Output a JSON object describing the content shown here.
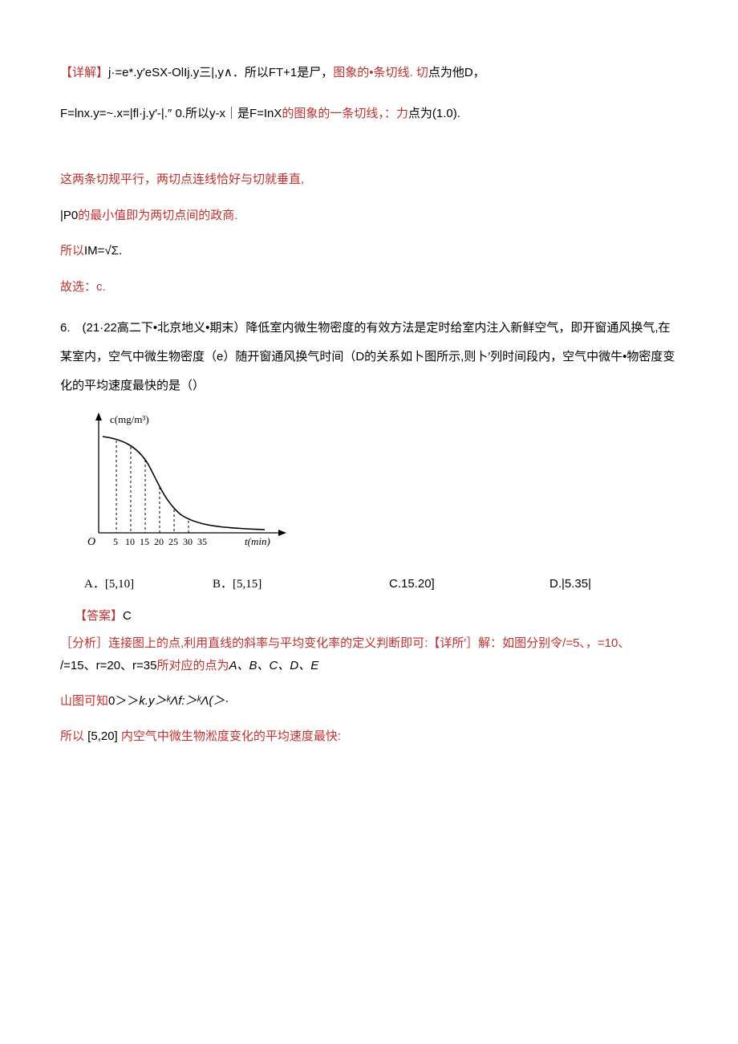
{
  "p1_prefix": "【详解】",
  "p1_body": "j·=e*.y′eSX-OlIj.y三|,y∧．所以FT+1是尸，",
  "p1_mid_red": "图象的•条切线. 切",
  "p1_tail": "点为他D，",
  "p2_body": "F=lnx.y=~.x=|fl·j.y′-|.″ 0.所以y-x｜是F=InX",
  "p2_mid_red": "的图象的一条切线，：力",
  "p2_tail": "点为(1.0).",
  "p3": "这两条切规平行，两切点连线恰好与切就垂直,",
  "p4_a": "|P0",
  "p4_b": "的最小值即为两切点间的政商.",
  "p5_a": "所以",
  "p5_b": "IM=√Σ.",
  "p6": "故选：c.",
  "q6_num": "6.　",
  "q6_src": "(21·22高二下•北京地义•期末）",
  "q6_body": "降低室内微生物密度的有效方法是定时给室内注入新鲜空气，即开窗通风换气,在某室内，空气中微生物密度（e）随开窗通风换气时间（D的关系如卜图所示,则卜′列时间段内，空气中微牛•物密度变化的平均速度最快的是（）",
  "chart": {
    "y_label": "c(mg/m³)",
    "x_label": "t(min)",
    "ticks": [
      "5",
      "10",
      "15",
      "20",
      "25",
      "30",
      "35"
    ]
  },
  "opts": {
    "a_label": "A．",
    "a_val": "[5,10]",
    "b_label": "B．",
    "b_val": "[5,15]",
    "c": "C.15.20]",
    "d": "D.|5.35|"
  },
  "ans_prefix": "【答案】",
  "ans_val": "C",
  "analysis_a": "［分析］连接图上的点,利用直线的斜率与平均变化率的定义判断即可:【详所′］解：如图分别令/=5、，=10、",
  "analysis_b_a": "/=15、r=20、r=35",
  "analysis_b_b": "所对应的点为",
  "analysis_b_c": "A、B、C、D、E",
  "p_slope": "山图可知0＞＞k.y＞ᵏΛf:＞ᵏΛ(＞·",
  "p_concl_a": "所以",
  "p_concl_b": " [5,20] ",
  "p_concl_c": "内空气中微生物淞度变化的平均速度最快:"
}
